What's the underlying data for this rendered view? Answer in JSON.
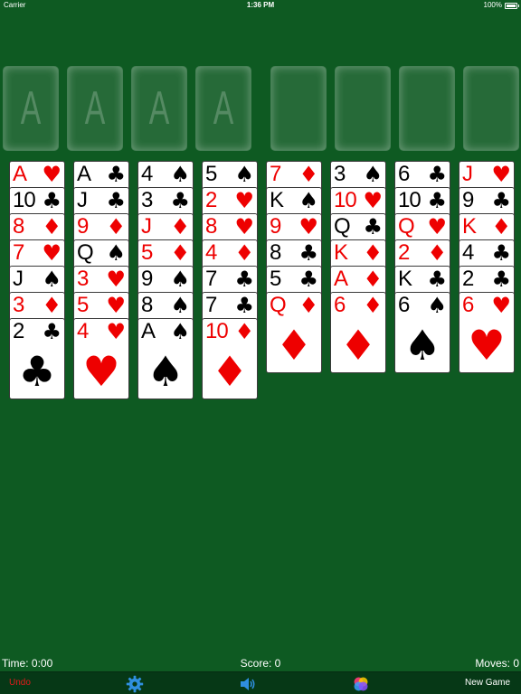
{
  "status": {
    "carrier": "Carrier",
    "time": "1:36 PM",
    "battery": "100%",
    "battery_level": 1.0
  },
  "foundations": [
    {
      "label": "A"
    },
    {
      "label": "A"
    },
    {
      "label": "A"
    },
    {
      "label": "A"
    }
  ],
  "free_cells": [
    {},
    {},
    {},
    {}
  ],
  "columns": [
    [
      {
        "rank": "A",
        "suit": "♥"
      },
      {
        "rank": "10",
        "suit": "♣"
      },
      {
        "rank": "8",
        "suit": "♦"
      },
      {
        "rank": "7",
        "suit": "♥"
      },
      {
        "rank": "J",
        "suit": "♠"
      },
      {
        "rank": "3",
        "suit": "♦"
      },
      {
        "rank": "2",
        "suit": "♣"
      }
    ],
    [
      {
        "rank": "A",
        "suit": "♣"
      },
      {
        "rank": "J",
        "suit": "♣"
      },
      {
        "rank": "9",
        "suit": "♦"
      },
      {
        "rank": "Q",
        "suit": "♠"
      },
      {
        "rank": "3",
        "suit": "♥"
      },
      {
        "rank": "5",
        "suit": "♥"
      },
      {
        "rank": "4",
        "suit": "♥"
      }
    ],
    [
      {
        "rank": "4",
        "suit": "♠"
      },
      {
        "rank": "3",
        "suit": "♣"
      },
      {
        "rank": "J",
        "suit": "♦"
      },
      {
        "rank": "5",
        "suit": "♦"
      },
      {
        "rank": "9",
        "suit": "♠"
      },
      {
        "rank": "8",
        "suit": "♠"
      },
      {
        "rank": "A",
        "suit": "♠"
      }
    ],
    [
      {
        "rank": "5",
        "suit": "♠"
      },
      {
        "rank": "2",
        "suit": "♥"
      },
      {
        "rank": "8",
        "suit": "♥"
      },
      {
        "rank": "4",
        "suit": "♦"
      },
      {
        "rank": "7",
        "suit": "♣"
      },
      {
        "rank": "7",
        "suit": "♣"
      },
      {
        "rank": "10",
        "suit": "♦"
      }
    ],
    [
      {
        "rank": "7",
        "suit": "♦"
      },
      {
        "rank": "K",
        "suit": "♠"
      },
      {
        "rank": "9",
        "suit": "♥"
      },
      {
        "rank": "8",
        "suit": "♣"
      },
      {
        "rank": "5",
        "suit": "♣"
      },
      {
        "rank": "Q",
        "suit": "♦"
      }
    ],
    [
      {
        "rank": "3",
        "suit": "♠"
      },
      {
        "rank": "10",
        "suit": "♥"
      },
      {
        "rank": "Q",
        "suit": "♣"
      },
      {
        "rank": "K",
        "suit": "♦"
      },
      {
        "rank": "A",
        "suit": "♦"
      },
      {
        "rank": "6",
        "suit": "♦"
      }
    ],
    [
      {
        "rank": "6",
        "suit": "♣"
      },
      {
        "rank": "10",
        "suit": "♣"
      },
      {
        "rank": "Q",
        "suit": "♥"
      },
      {
        "rank": "2",
        "suit": "♦"
      },
      {
        "rank": "K",
        "suit": "♣"
      },
      {
        "rank": "6",
        "suit": "♠"
      }
    ],
    [
      {
        "rank": "J",
        "suit": "♥"
      },
      {
        "rank": "9",
        "suit": "♣"
      },
      {
        "rank": "K",
        "suit": "♦"
      },
      {
        "rank": "4",
        "suit": "♣"
      },
      {
        "rank": "2",
        "suit": "♣"
      },
      {
        "rank": "6",
        "suit": "♥"
      }
    ]
  ],
  "info": {
    "time": "Time: 0:00",
    "score": "Score: 0",
    "moves": "Moves: 0"
  },
  "toolbar": {
    "undo_label": "Undo",
    "new_game_label": "New Game",
    "settings_icon": "gear-icon",
    "sound_icon": "speaker-icon",
    "games_icon": "game-center-icon"
  },
  "colors": {
    "felt": "#0e5a22",
    "red_suit": "#ee0000",
    "black_suit": "#000000",
    "undo": "#e31b1b",
    "toolbar_icons": "#2f8fe0"
  }
}
